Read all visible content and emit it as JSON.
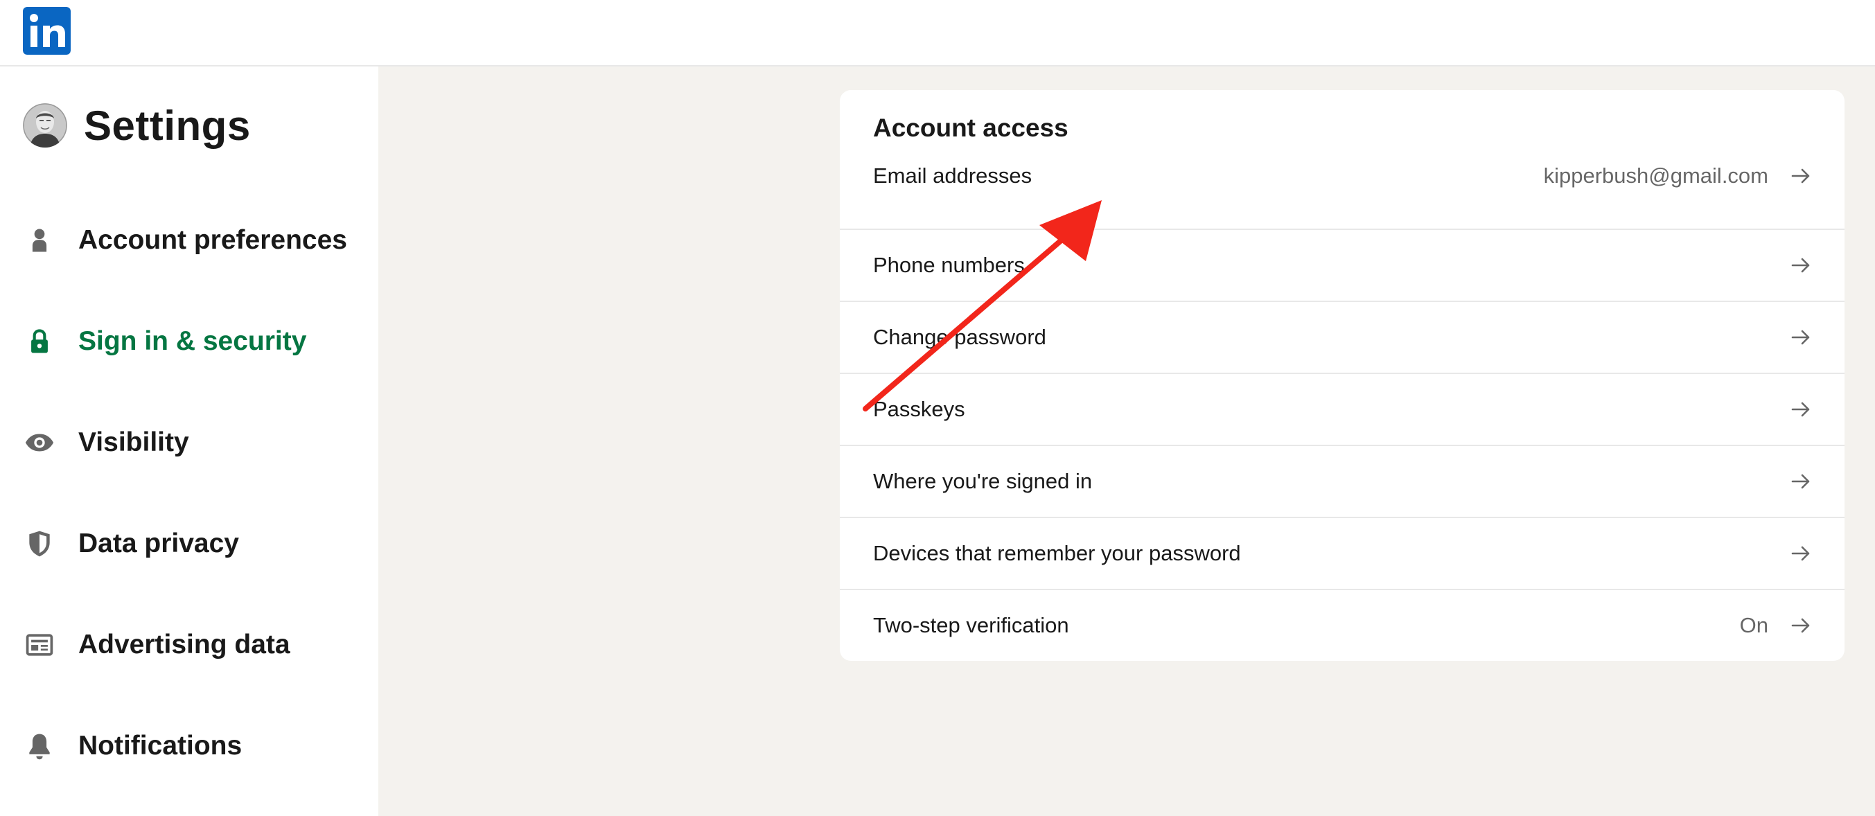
{
  "header": {
    "logo_text": "in",
    "logo_color": "#0a66c2"
  },
  "sidebar": {
    "title": "Settings",
    "items": [
      {
        "label": "Account preferences",
        "icon": "person-icon",
        "active": false
      },
      {
        "label": "Sign in & security",
        "icon": "lock-icon",
        "active": true
      },
      {
        "label": "Visibility",
        "icon": "eye-icon",
        "active": false
      },
      {
        "label": "Data privacy",
        "icon": "shield-icon",
        "active": false
      },
      {
        "label": "Advertising data",
        "icon": "newspaper-icon",
        "active": false
      },
      {
        "label": "Notifications",
        "icon": "bell-icon",
        "active": false
      }
    ]
  },
  "account_access": {
    "title": "Account access",
    "rows": [
      {
        "label": "Email addresses",
        "value": "kipperbush@gmail.com",
        "icon": "arrow-right-icon"
      },
      {
        "label": "Phone numbers",
        "value": "",
        "icon": "arrow-right-icon"
      },
      {
        "label": "Change password",
        "value": "",
        "icon": "arrow-right-icon"
      },
      {
        "label": "Passkeys",
        "value": "",
        "icon": "arrow-right-icon"
      },
      {
        "label": "Where you're signed in",
        "value": "",
        "icon": "arrow-right-icon"
      },
      {
        "label": "Devices that remember your password",
        "value": "",
        "icon": "arrow-right-icon"
      },
      {
        "label": "Two-step verification",
        "value": "On",
        "icon": "arrow-right-icon"
      }
    ]
  },
  "colors": {
    "brand": "#0a66c2",
    "active_green": "#057642",
    "page_background": "#f4f2ee",
    "annotation_arrow": "#f2261b"
  }
}
